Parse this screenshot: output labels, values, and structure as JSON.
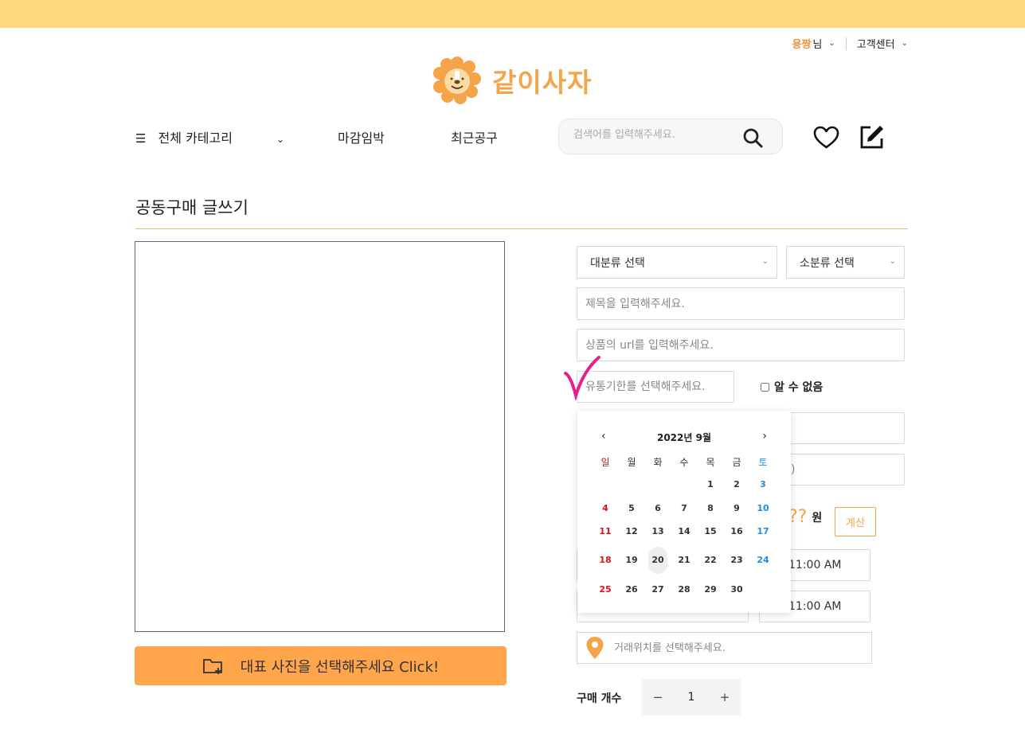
{
  "header": {
    "user_name": "용짱",
    "user_suffix": "님",
    "customer_center": "고객센터",
    "brand": "같이사자"
  },
  "nav": {
    "all_category": "전체 카테고리",
    "deadline": "마감임박",
    "recent": "최근공구",
    "search_placeholder": "검색어를 입력해주세요."
  },
  "page": {
    "title": "공동구매 글쓰기",
    "photo_button": "대표 사진을 선택해주세요 Click!"
  },
  "form": {
    "major_category": "대분류 선택",
    "minor_category": "소분류 선택",
    "title_placeholder": "제목을 입력해주세요.",
    "url_placeholder": "상품의 url를 입력해주세요.",
    "expiry_placeholder": "유통기한를 선택해주세요.",
    "unknown_label": "알 수 없음",
    "hidden_field_fragment": ")",
    "price_value": "??",
    "price_unit": "원",
    "calc_button": "계산",
    "time1": "11:00 AM",
    "time2": "11:00 AM",
    "location_placeholder": "거래위치를 선택해주세요.",
    "qty_label": "구매 개수",
    "qty_minus": "−",
    "qty_value": "1",
    "qty_plus": "+"
  },
  "calendar": {
    "month_label": "2022년 9월",
    "prev": "‹",
    "next": "›",
    "weekdays": [
      "일",
      "월",
      "화",
      "수",
      "목",
      "금",
      "토"
    ],
    "weeks": [
      [
        "",
        "",
        "",
        "",
        "1",
        "2",
        "3"
      ],
      [
        "4",
        "5",
        "6",
        "7",
        "8",
        "9",
        "10"
      ],
      [
        "11",
        "12",
        "13",
        "14",
        "15",
        "16",
        "17"
      ],
      [
        "18",
        "19",
        "20",
        "21",
        "22",
        "23",
        "24"
      ],
      [
        "25",
        "26",
        "27",
        "28",
        "29",
        "30",
        ""
      ]
    ],
    "today": "20"
  },
  "colors": {
    "accent": "#f6a44a",
    "topbar": "#ffd77f",
    "sunday": "#d41616",
    "saturday": "#1e8fdd"
  }
}
